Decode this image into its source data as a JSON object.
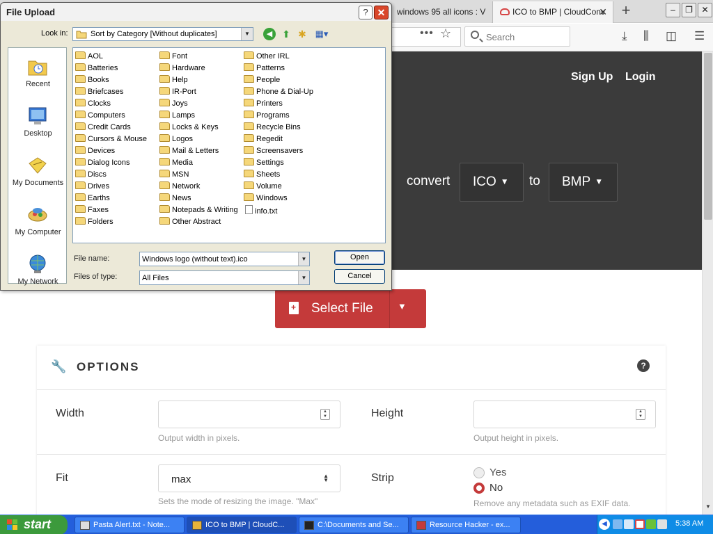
{
  "browser": {
    "tabs": [
      {
        "label": "windows 95 all icons : V"
      },
      {
        "label": "ICO to BMP | CloudConv"
      }
    ],
    "toolbar": {
      "search_placeholder": "Search"
    }
  },
  "page": {
    "nav": {
      "signup": "Sign Up",
      "login": "Login"
    },
    "converter": {
      "convert_label": "convert",
      "from_format": "ICO",
      "to_label": "to",
      "to_format": "BMP"
    },
    "select_file_label": "Select File",
    "options": {
      "title": "OPTIONS",
      "width_label": "Width",
      "width_hint": "Output width in pixels.",
      "height_label": "Height",
      "height_hint": "Output height in pixels.",
      "fit_label": "Fit",
      "fit_value": "max",
      "fit_hint": "Sets the mode of resizing the image. \"Max\"",
      "strip_label": "Strip",
      "strip_yes": "Yes",
      "strip_no": "No",
      "strip_selected": "No",
      "strip_hint": "Remove any metadata such as EXIF data."
    }
  },
  "dialog": {
    "title": "File Upload",
    "help_label": "?",
    "lookin_label": "Look in:",
    "lookin_value": "Sort by Category [Without duplicates]",
    "places": [
      "Recent",
      "Desktop",
      "My Documents",
      "My Computer",
      "My Network"
    ],
    "files": [
      "AOL",
      "Batteries",
      "Books",
      "Briefcases",
      "Clocks",
      "Computers",
      "Credit Cards",
      "Cursors & Mouse",
      "Devices",
      "Dialog Icons",
      "Discs",
      "Drives",
      "Earths",
      "Faxes",
      "Folders",
      "Font",
      "Hardware",
      "Help",
      "IR-Port",
      "Joys",
      "Lamps",
      "Locks & Keys",
      "Logos",
      "Mail & Letters",
      "Media",
      "MSN",
      "Network",
      "News",
      "Notepads & Writing",
      "Other Abstract",
      "Other IRL",
      "Patterns",
      "People",
      "Phone & Dial-Up",
      "Printers",
      "Programs",
      "Recycle Bins",
      "Regedit",
      "Screensavers",
      "Settings",
      "Sheets",
      "Volume",
      "Windows",
      "info.txt"
    ],
    "filename_label": "File name:",
    "filename_value": "Windows logo (without text).ico",
    "filetype_label": "Files of type:",
    "filetype_value": "All Files",
    "open_label": "Open",
    "cancel_label": "Cancel"
  },
  "taskbar": {
    "start_label": "start",
    "tasks": [
      {
        "label": "Pasta Alert.txt - Note..."
      },
      {
        "label": "ICO to BMP | CloudC..."
      },
      {
        "label": "C:\\Documents and Se..."
      },
      {
        "label": "Resource Hacker - ex..."
      }
    ],
    "clock": "5:38 AM"
  },
  "colors": {
    "accent_red": "#c43a3a",
    "hero_bg": "#3b3b3b",
    "taskbar_blue": "#245edb",
    "start_green": "#3c9a3c"
  }
}
